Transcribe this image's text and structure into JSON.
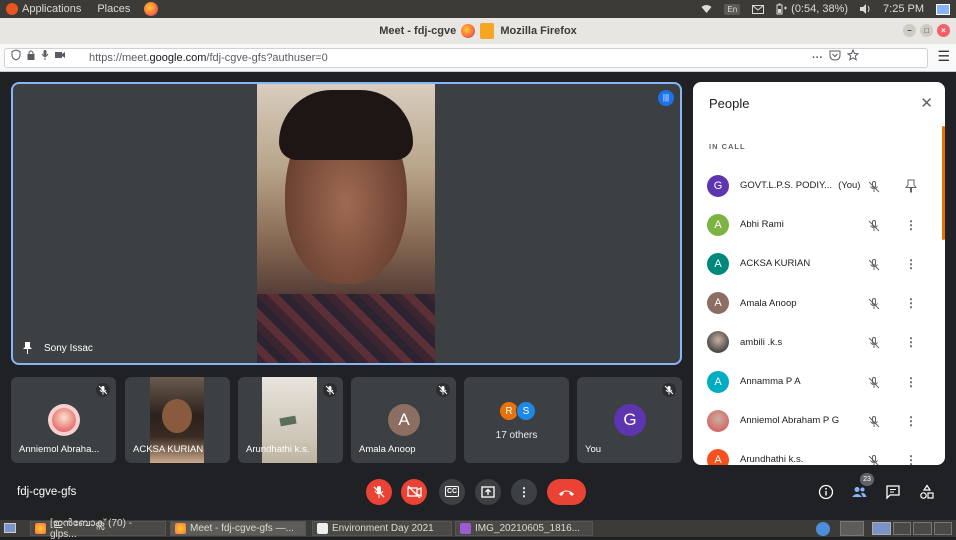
{
  "topbar": {
    "applications": "Applications",
    "places": "Places",
    "keyboard": "En",
    "battery": "(0:54, 38%)",
    "time": "7:25 PM"
  },
  "window": {
    "title": "Meet - fdj-cgve",
    "title_suffix": "Mozilla Firefox"
  },
  "browser": {
    "url_prefix": "https://meet.",
    "url_domain": "google.com",
    "url_path": "/fdj-cgve-gfs?authuser=0"
  },
  "main_tile": {
    "name": "Sony Issac"
  },
  "tiles": [
    {
      "name": "Anniemol Abraha..."
    },
    {
      "name": "ACKSA KURIAN"
    },
    {
      "name": "Arundhathi k.s."
    },
    {
      "name": "Amala Anoop",
      "initial": "A",
      "color": "#8d6e63"
    },
    {
      "name": "17 others",
      "chips": [
        "R",
        "S"
      ],
      "chip_colors": [
        "#e8710a",
        "#1e88e5"
      ]
    },
    {
      "name": "You",
      "initial": "G",
      "color": "#5e35b1"
    }
  ],
  "people_panel": {
    "title": "People",
    "section": "IN CALL",
    "participants": [
      {
        "initial": "G",
        "name": "GOVT.L.P.S. PODIY...",
        "suffix": "(You)",
        "color": "#5e35b1",
        "action": "pin"
      },
      {
        "initial": "A",
        "name": "Abhi Rami",
        "color": "#7cb342",
        "action": "more"
      },
      {
        "initial": "A",
        "name": "ACKSA KURIAN",
        "color": "#00897b",
        "action": "more"
      },
      {
        "initial": "A",
        "name": "Amala Anoop",
        "color": "#8d6e63",
        "action": "more"
      },
      {
        "initial": "",
        "name": "ambili .k.s",
        "color": "#4a4a4a",
        "action": "more"
      },
      {
        "initial": "A",
        "name": "Annamma P A",
        "color": "#00acc1",
        "action": "more"
      },
      {
        "initial": "",
        "name": "Anniemol Abraham P G",
        "color": "#d46a6a",
        "action": "more"
      },
      {
        "initial": "A",
        "name": "Arundhathi k.s.",
        "color": "#f4511e",
        "action": "more"
      }
    ]
  },
  "controls": {
    "meeting_code": "fdj-cgve-gfs",
    "participant_count": "23",
    "cc_label": "CC"
  },
  "taskbar": [
    {
      "label": "[ഇൻബോക്സ് (70) - glps..."
    },
    {
      "label": "Meet - fdj-cgve-gfs —..."
    },
    {
      "label": "Environment Day 2021"
    },
    {
      "label": "IMG_20210605_1816..."
    }
  ],
  "colors": {
    "meet_bg": "#202124",
    "tile_bg": "#3c4043",
    "accent_blue": "#8ab4f8",
    "danger_red": "#ea4335"
  }
}
